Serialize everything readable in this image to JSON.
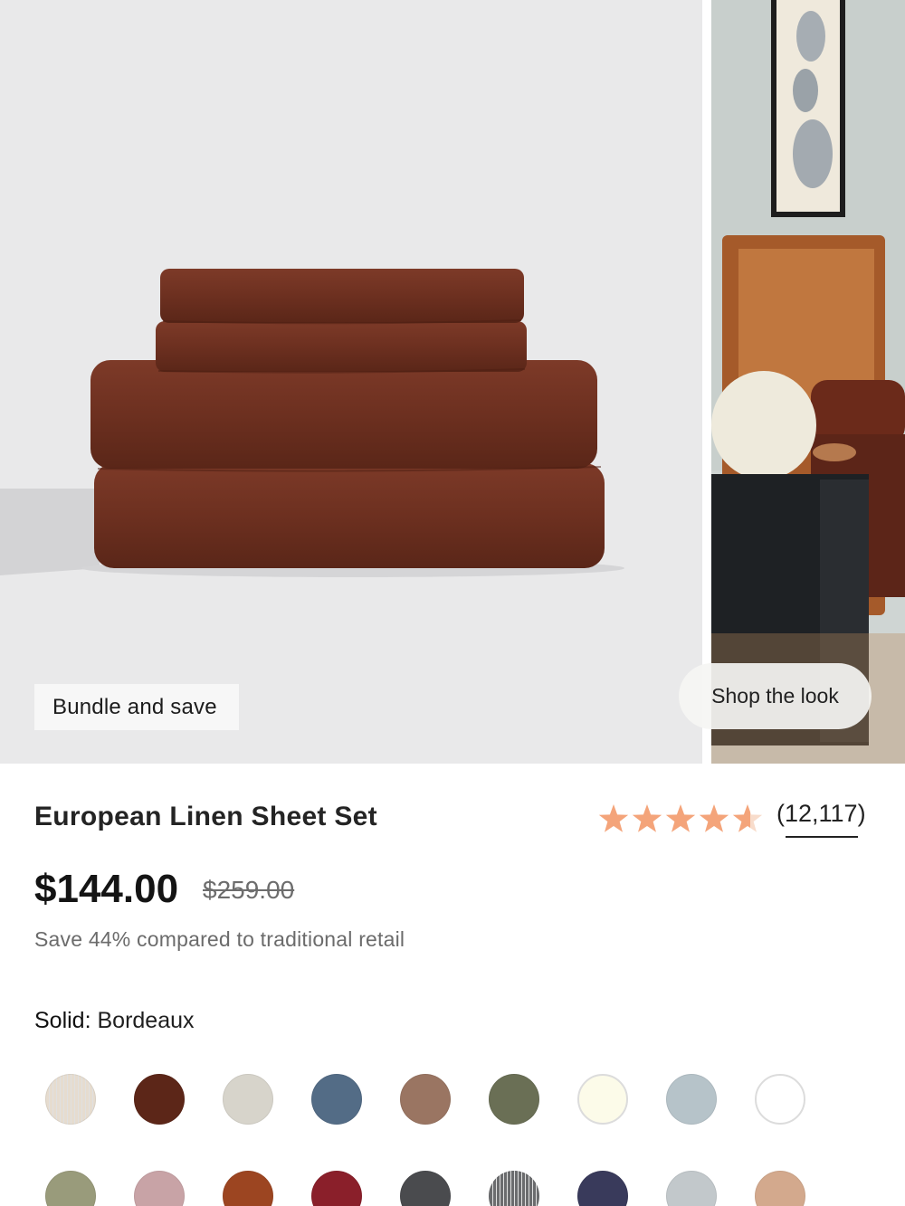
{
  "gallery": {
    "badge": "Bundle and save",
    "shop_the_look": "Shop the look"
  },
  "product": {
    "title": "European Linen Sheet Set",
    "rating": 4.6,
    "rating_max": 5,
    "review_count": "(12,117)",
    "price": "$144.00",
    "original_price": "$259.00",
    "savings_text": "Save 44% compared to traditional retail"
  },
  "colors": {
    "group_label": "Solid:",
    "selected_name": "Bordeaux",
    "swatches": [
      {
        "color": "#e6dccf",
        "pattern": "stripe"
      },
      {
        "color": "#5c2618"
      },
      {
        "color": "#d7d4cb"
      },
      {
        "color": "#536c86"
      },
      {
        "color": "#9a7562"
      },
      {
        "color": "#6a6f55"
      },
      {
        "color": "#fcfbe9"
      },
      {
        "color": "#b6c3c9"
      },
      {
        "color": "#ffffff"
      },
      {
        "color": "#999b7b"
      },
      {
        "color": "#c8a3a6"
      },
      {
        "color": "#9c4521"
      },
      {
        "color": "#8a1f2a"
      },
      {
        "color": "#4a4b4e"
      },
      {
        "color": "#6b6c6e",
        "pattern": "stripe"
      },
      {
        "color": "#393a5b"
      },
      {
        "color": "#c2c8cb"
      },
      {
        "color": "#d3a98d"
      }
    ]
  },
  "theme": {
    "star_color": "#f4a47a",
    "star_empty": "#f8dccb"
  }
}
